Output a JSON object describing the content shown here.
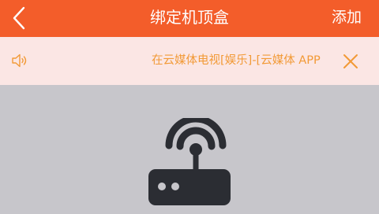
{
  "nav": {
    "title": "绑定机顶盒",
    "add_label": "添加",
    "back_icon": "chevron-left-icon"
  },
  "notice": {
    "icon": "speaker-icon",
    "text": "在云媒体电视[娱乐]-[云媒体 APP",
    "close_icon": "close-icon"
  },
  "main": {
    "illustration_icon": "set-top-box-wifi-icon"
  },
  "colors": {
    "brand": "#f35d2a",
    "notice_background": "#fbe6e4",
    "notice_text": "#f29a37",
    "page_background": "#c7c6cb",
    "icon_dark": "#2b2d33"
  }
}
